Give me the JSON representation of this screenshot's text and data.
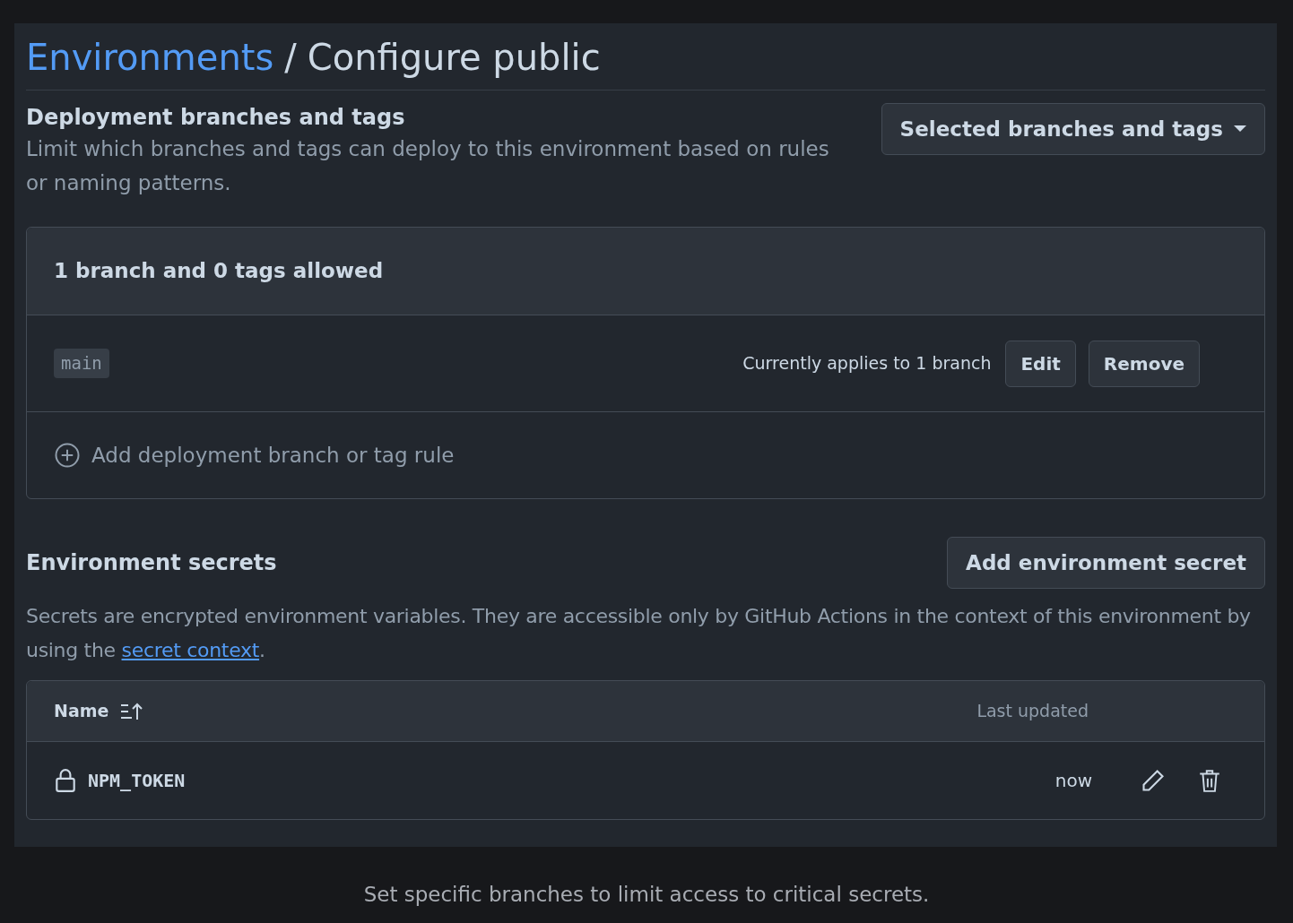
{
  "breadcrumb": {
    "parent": "Environments",
    "separator": "/",
    "current": "Configure public"
  },
  "deployment": {
    "title": "Deployment branches and tags",
    "description": "Limit which branches and tags can deploy to this environment based on rules or naming patterns.",
    "dropdown": "Selected branches and tags",
    "box": {
      "header": "1 branch and 0 tags allowed",
      "rules": [
        {
          "pattern": "main",
          "applies": "Currently applies to 1 branch",
          "buttons": [
            "Edit",
            "Remove"
          ]
        }
      ],
      "add_rule": "Add deployment branch or tag rule"
    }
  },
  "secrets": {
    "title": "Environment secrets",
    "add_button": "Add environment secret",
    "description_before": "Secrets are encrypted environment variables. They are accessible only by GitHub Actions in the context of this environment by using the ",
    "link": "secret context",
    "description_after": ".",
    "table": {
      "columns": [
        "Name",
        "Last updated"
      ],
      "rows": [
        {
          "name": "NPM_TOKEN",
          "updated": "now"
        }
      ]
    }
  },
  "caption": "Set specific branches to limit access to critical secrets."
}
